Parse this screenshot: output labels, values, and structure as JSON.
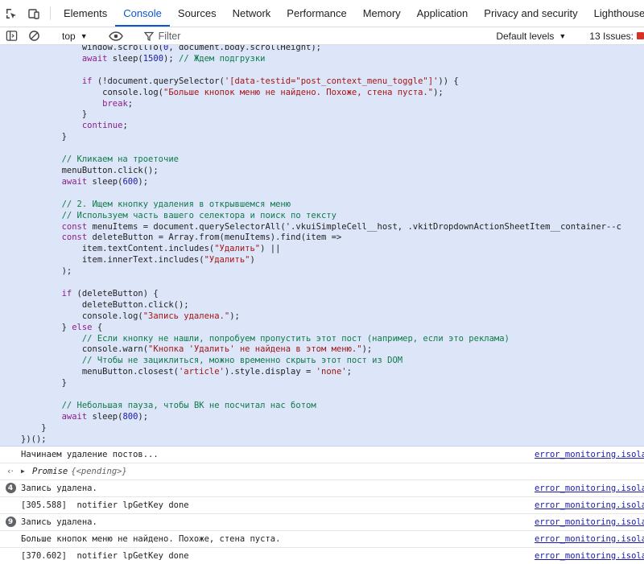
{
  "tabs": [
    "Elements",
    "Console",
    "Sources",
    "Network",
    "Performance",
    "Memory",
    "Application",
    "Privacy and security",
    "Lighthouse"
  ],
  "more_tabs": ">>",
  "toolbar": {
    "context": "top",
    "filter_placeholder": "Filter",
    "levels": "Default levels",
    "issues": "13 Issues:"
  },
  "code_lines": [
    "            window.scrollTo(0, document.body.scrollHeight);",
    "            await sleep(1500); // Ждем подгрузки",
    "",
    "            if (!document.querySelector('[data-testid=\"post_context_menu_toggle\"]')) {",
    "                console.log(\"Больше кнопок меню не найдено. Похоже, стена пуста.\");",
    "                break;",
    "            }",
    "            continue;",
    "        }",
    "",
    "        // Кликаем на троеточие",
    "        menuButton.click();",
    "        await sleep(600);",
    "",
    "        // 2. Ищем кнопку удаления в открывшемся меню",
    "        // Используем часть вашего селектора и поиск по тексту",
    "        const menuItems = document.querySelectorAll('.vkuiSimpleCell__host, .vkitDropdownActionSheetItem__container--c",
    "        const deleteButton = Array.from(menuItems).find(item =>",
    "            item.textContent.includes(\"Удалить\") ||",
    "            item.innerText.includes(\"Удалить\")",
    "        );",
    "",
    "        if (deleteButton) {",
    "            deleteButton.click();",
    "            console.log(\"Запись удалена.\");",
    "        } else {",
    "            // Если кнопку не нашли, попробуем пропустить этот пост (например, если это реклама)",
    "            console.warn(\"Кнопка 'Удалить' не найдена в этом меню.\");",
    "            // Чтобы не зациклиться, можно временно скрыть этот пост из DOM",
    "            menuButton.closest('article').style.display = 'none';",
    "        }",
    "",
    "        // Небольшая пауза, чтобы ВК не посчитал нас ботом",
    "        await sleep(800);",
    "    }",
    "})();"
  ],
  "messages": [
    {
      "type": "log",
      "count": "",
      "text": "Начинаем удаление постов...",
      "source": "error_monitoring.isolated"
    },
    {
      "type": "result",
      "count": "",
      "text": "Promise",
      "pending": "{<pending>}",
      "source": ""
    },
    {
      "type": "log",
      "count": "4",
      "text": "Запись удалена.",
      "source": "error_monitoring.isolated"
    },
    {
      "type": "log",
      "count": "",
      "text": "[305.588]  notifier lpGetKey done",
      "source": "error_monitoring.isolated"
    },
    {
      "type": "log",
      "count": "9",
      "text": "Запись удалена.",
      "source": "error_monitoring.isolated"
    },
    {
      "type": "log",
      "count": "",
      "text": "Больше кнопок меню не найдено. Похоже, стена пуста.",
      "source": "error_monitoring.isolated"
    },
    {
      "type": "log",
      "count": "",
      "text": "[370.602]  notifier lpGetKey done",
      "source": "error_monitoring.isolated"
    }
  ],
  "colors": {
    "accent": "#0b57d0",
    "command_bg": "#dce6f8",
    "comment": "#0f7a4a",
    "string": "#a31515",
    "keyword": "#8b1e8b",
    "number": "#1a1aa6"
  }
}
